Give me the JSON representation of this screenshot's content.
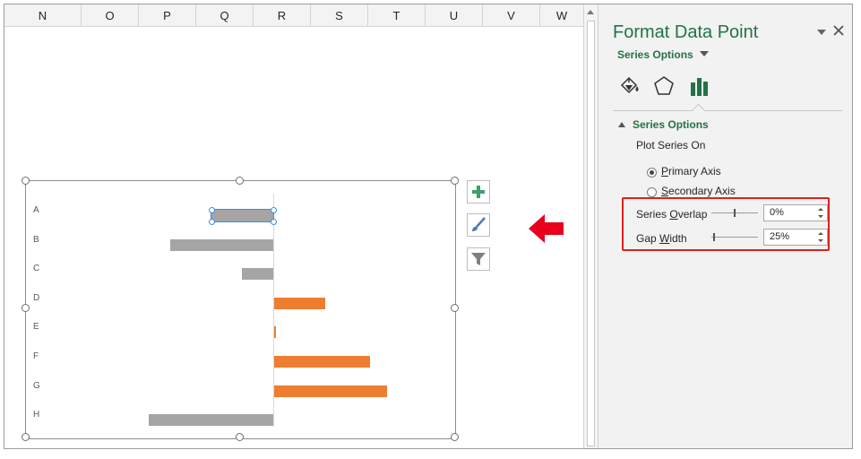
{
  "spreadsheet": {
    "columns": [
      "N",
      "O",
      "P",
      "Q",
      "R",
      "S",
      "T",
      "U",
      "V",
      "W"
    ]
  },
  "chart": {
    "bar_colors": {
      "negative": "#a5a5a5",
      "positive": "#ed7d31"
    }
  },
  "chart_data": {
    "type": "bar",
    "orientation": "horizontal",
    "categories": [
      "A",
      "B",
      "C",
      "D",
      "E",
      "F",
      "G",
      "H"
    ],
    "values": [
      -90,
      -149,
      -45,
      74,
      3,
      139,
      163,
      -180
    ],
    "xlim": [
      -180,
      180
    ],
    "selected_point": "A",
    "grid": false
  },
  "chart_buttons": [
    "chart-elements-icon",
    "chart-styles-icon",
    "chart-filters-icon"
  ],
  "format_pane": {
    "title": "Format Data Point",
    "series_dropdown": "Series Options",
    "tabs": [
      "fill-line-icon",
      "effects-icon",
      "series-options-icon"
    ],
    "section": {
      "title": "Series Options",
      "plot_series_on": "Plot Series On",
      "primary_axis": {
        "label": "Primary Axis",
        "selected": true
      },
      "secondary_axis": {
        "label": "Secondary Axis",
        "selected": false
      },
      "series_overlap": {
        "label": "Series Overlap",
        "value": "0%",
        "level": 0.5
      },
      "gap_width": {
        "label": "Gap Width",
        "value": "25%",
        "level": 0.05
      }
    }
  },
  "colors": {
    "accent_green": "#217346",
    "highlight_red": "#e0201b",
    "arrow_red": "#e8001c"
  }
}
